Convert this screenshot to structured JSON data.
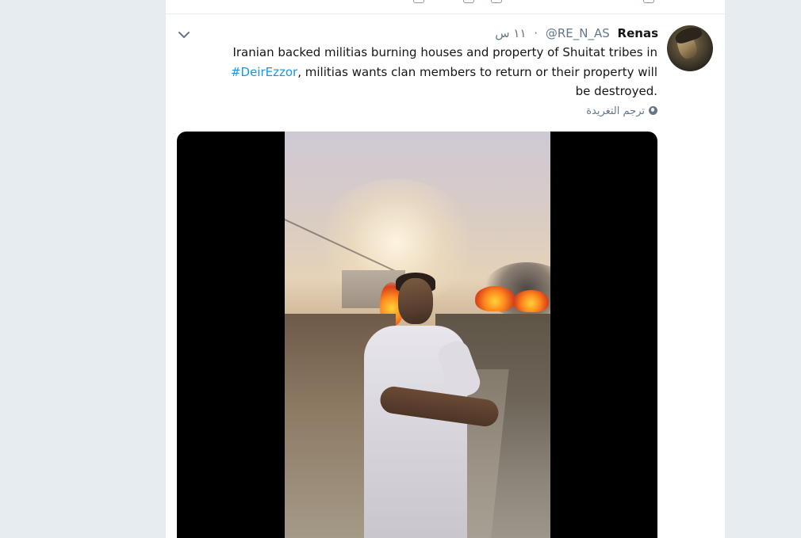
{
  "tweet": {
    "display_name": "Renas",
    "handle": "@RE_N_AS",
    "separator": "·",
    "timestamp": "١١ س",
    "text_before_hashtag": "Iranian backed militias burning houses and property of Shuitat tribes in",
    "hashtag": "#DeirEzzor",
    "text_after_hashtag": ", militias wants clan members to return or their property will be destroyed.",
    "translate_label": "ترجم التغريدة"
  },
  "icons": {
    "caret": "chevron-down-icon",
    "translate": "globe-icon",
    "avatar": "user-avatar"
  },
  "colors": {
    "link": "#1b95e0",
    "secondary_text": "#657786",
    "primary_text": "#14171a",
    "background": "#e6ecf0"
  }
}
